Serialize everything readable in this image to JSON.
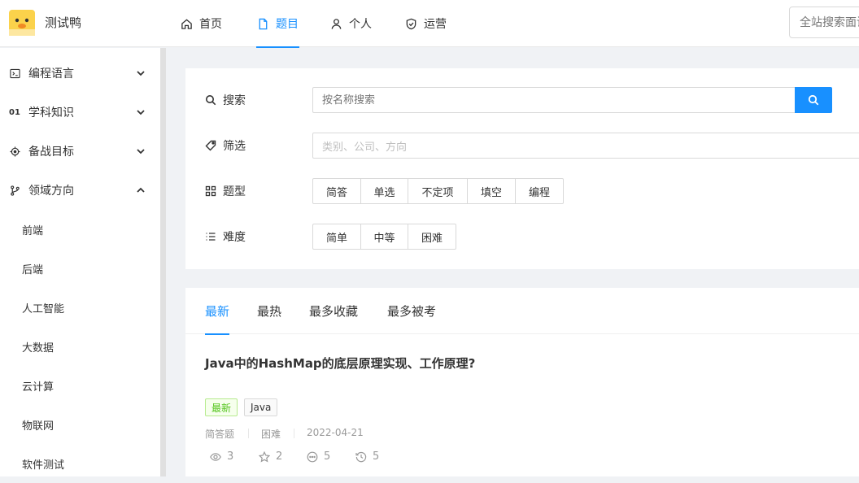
{
  "app": {
    "name": "测试鸭",
    "logo_icon": "duck-logo-icon"
  },
  "topnav": [
    {
      "label": "首页",
      "icon": "home-icon"
    },
    {
      "label": "题目",
      "icon": "file-icon",
      "active": true
    },
    {
      "label": "个人",
      "icon": "user-icon"
    },
    {
      "label": "运营",
      "icon": "shield-icon"
    }
  ],
  "global_search": {
    "placeholder": "全站搜索面试题"
  },
  "sidebar": {
    "groups": [
      {
        "label": "编程语言",
        "icon": "code-icon",
        "expanded": false
      },
      {
        "label": "学科知识",
        "icon": "01",
        "expanded": false
      },
      {
        "label": "备战目标",
        "icon": "target-icon",
        "expanded": false
      },
      {
        "label": "领域方向",
        "icon": "branch-icon",
        "expanded": true
      }
    ],
    "sub_items": [
      "前端",
      "后端",
      "人工智能",
      "大数据",
      "云计算",
      "物联网",
      "软件测试"
    ]
  },
  "filters": {
    "search": {
      "label": "搜索",
      "placeholder": "按名称搜索"
    },
    "select": {
      "label": "筛选",
      "placeholder": "类别、公司、方向"
    },
    "type": {
      "label": "题型",
      "options": [
        "简答",
        "单选",
        "不定项",
        "填空",
        "编程"
      ]
    },
    "difficulty": {
      "label": "难度",
      "options": [
        "简单",
        "中等",
        "困难"
      ]
    }
  },
  "tabs": [
    "最新",
    "最热",
    "最多收藏",
    "最多被考"
  ],
  "active_tab": "最新",
  "question": {
    "title": "Java中的HashMap的底层原理实现、工作原理?",
    "tags": [
      "最新",
      "Java"
    ],
    "meta": [
      "简答题",
      "困难",
      "2022-04-21"
    ],
    "stats": {
      "views": "3",
      "stars": "2",
      "comments": "5",
      "history": "5"
    }
  },
  "colors": {
    "primary": "#1890ff",
    "tag_green": "#52c41a",
    "duck_yellow": "#fbd24b"
  }
}
